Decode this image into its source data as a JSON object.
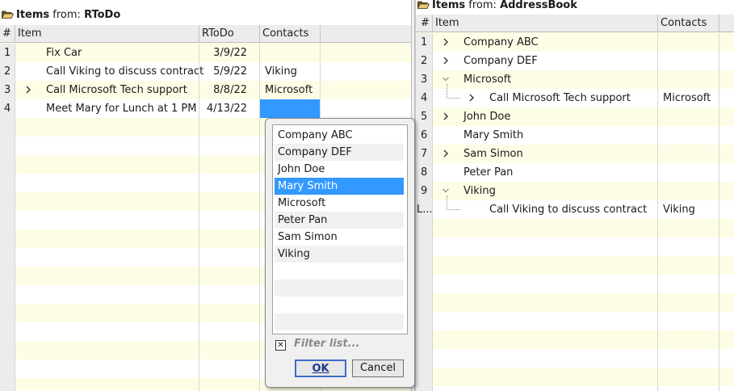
{
  "left": {
    "title_prefix": "Items",
    "title_from": " from: ",
    "title_source": "RToDo",
    "columns": {
      "num": "#",
      "item": "Item",
      "rtodo": "RToDo",
      "contacts": "Contacts"
    },
    "rows": [
      {
        "num": "1",
        "item": "Fix Car",
        "date": "3/9/22",
        "contact": "",
        "expand": false
      },
      {
        "num": "2",
        "item": "Call Viking to discuss contract",
        "date": "5/9/22",
        "contact": "Viking",
        "expand": false
      },
      {
        "num": "3",
        "item": "Call Microsoft Tech support",
        "date": "8/8/22",
        "contact": "Microsoft",
        "expand": true
      },
      {
        "num": "4",
        "item": "Meet Mary for Lunch at 1 PM",
        "date": "4/13/22",
        "contact": "",
        "expand": false
      }
    ]
  },
  "right": {
    "title_prefix": "Items",
    "title_from": " from: ",
    "title_source": "AddressBook",
    "columns": {
      "num": "#",
      "item": "Item",
      "contacts": "Contacts"
    },
    "rows": [
      {
        "num": "1",
        "item": "Company ABC",
        "contact": "",
        "chev": "right",
        "indent": 0
      },
      {
        "num": "2",
        "item": "Company DEF",
        "contact": "",
        "chev": "right",
        "indent": 0
      },
      {
        "num": "3",
        "item": "Microsoft",
        "contact": "",
        "chev": "down",
        "indent": 0
      },
      {
        "num": "4",
        "item": "Call Microsoft Tech support",
        "contact": "Microsoft",
        "chev": "right",
        "indent": 1
      },
      {
        "num": "5",
        "item": "John Doe",
        "contact": "",
        "chev": "right",
        "indent": 0
      },
      {
        "num": "6",
        "item": "Mary Smith",
        "contact": "",
        "chev": "",
        "indent": 0
      },
      {
        "num": "7",
        "item": "Sam Simon",
        "contact": "",
        "chev": "right",
        "indent": 0
      },
      {
        "num": "8",
        "item": "Peter Pan",
        "contact": "",
        "chev": "",
        "indent": 0
      },
      {
        "num": "9",
        "item": "Viking",
        "contact": "",
        "chev": "down",
        "indent": 0
      },
      {
        "num": "L...",
        "item": "Call Viking to discuss contract",
        "contact": "Viking",
        "chev": "",
        "indent": 1
      }
    ]
  },
  "popup": {
    "options": [
      "Company ABC",
      "Company DEF",
      "John Doe",
      "Mary Smith",
      "Microsoft",
      "Peter Pan",
      "Sam Simon",
      "Viking"
    ],
    "selected": "Mary Smith",
    "filter_checked": "✕",
    "filter_label": "Filter list...",
    "ok_label": "OK",
    "cancel_label": "Cancel"
  },
  "colors": {
    "selection": "#3399ff",
    "row_alt": "#fdfde6",
    "header": "#ececec"
  },
  "icons": {
    "title": "folder-open-icon",
    "expand": "chevron-right-icon",
    "collapse": "chevron-down-icon"
  }
}
